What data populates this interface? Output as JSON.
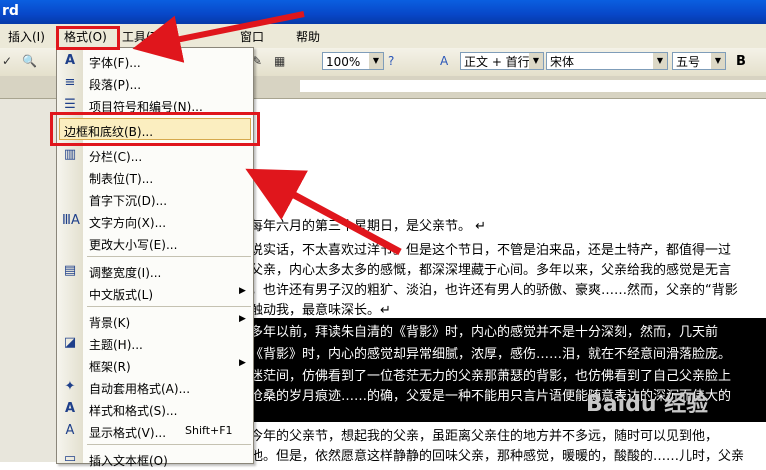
{
  "window": {
    "title_fragment": "rd"
  },
  "menubar": {
    "items": [
      {
        "label": "插入(I)"
      },
      {
        "label": "格式(O)"
      },
      {
        "label": "工具(T)"
      },
      {
        "label": "窗口"
      },
      {
        "label": "帮助"
      }
    ]
  },
  "toolbar": {
    "zoom": "100%",
    "style": "正文 + 首行",
    "font": "宋体",
    "size": "五号",
    "bold": "B"
  },
  "format_menu": {
    "items": [
      {
        "label": "字体(F)...",
        "icon": "font-icon"
      },
      {
        "label": "段落(P)...",
        "icon": "paragraph-icon"
      },
      {
        "label": "项目符号和编号(N)...",
        "icon": "bullets-icon"
      },
      {
        "label": "边框和底纹(B)...",
        "icon": ""
      },
      {
        "label": "分栏(C)...",
        "icon": "columns-icon"
      },
      {
        "label": "制表位(T)...",
        "icon": ""
      },
      {
        "label": "首字下沉(D)...",
        "icon": ""
      },
      {
        "label": "文字方向(X)...",
        "icon": "text-direction-icon"
      },
      {
        "label": "更改大小写(E)...",
        "icon": ""
      },
      {
        "label": "调整宽度(I)...",
        "icon": "fit-width-icon"
      },
      {
        "label": "中文版式(L)",
        "icon": "",
        "submenu": true
      },
      {
        "label": "背景(K)",
        "icon": "",
        "submenu": true
      },
      {
        "label": "主题(H)...",
        "icon": "theme-icon"
      },
      {
        "label": "框架(R)",
        "icon": "",
        "submenu": true
      },
      {
        "label": "自动套用格式(A)...",
        "icon": "autoformat-icon"
      },
      {
        "label": "样式和格式(S)...",
        "icon": "styles-icon"
      },
      {
        "label": "显示格式(V)...",
        "icon": "reveal-format-icon",
        "shortcut": "Shift+F1"
      },
      {
        "label": "插入文本框(O)",
        "icon": "textbox-icon"
      }
    ]
  },
  "document": {
    "lines": [
      "每年六月的第三个星期日，是父亲节。  ↵",
      "说实话，不太喜欢过洋节。但是这个节日，不管是泊来品，还是土特产，都值得一过",
      "父亲，内心太多太多的感慨，都深深埋藏于心间。多年以来，父亲给我的感觉是无言",
      "，也许还有男子汉的粗犷、淡泊，也许还有男人的骄傲、豪爽……然而，父亲的“背影",
      "触动我，最意味深长。↵",
      "多年以前，拜读朱自清的《背影》时，内心的感觉并不是十分深刻，然而，几天前",
      "《背影》时，内心的感觉却异常细腻，浓厚，感伤……泪，就在不经意间滑落脸庞。",
      "迷茫间，仿佛看到了一位苍茫无力的父亲那萧瑟的背影，也仿佛看到了自己父亲脸上",
      "沧桑的岁月痕迹……的确，父爱是一种不能用只言片语便能随意表达的深沉而伟大的",
      "今年的父亲节，想起我的父亲，虽距离父亲住的地方并不多远，随时可以见到他，",
      "他。但是，依然愿意这样静静的回味父亲，那种感觉，暖暖的，酸酸的……儿时，父亲"
    ]
  },
  "watermark": "Baidu 经验"
}
